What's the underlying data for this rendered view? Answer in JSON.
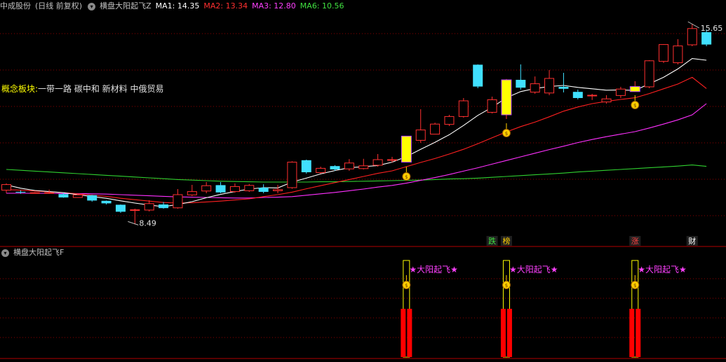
{
  "header": {
    "stock": "中成股份",
    "period": "(日线 前复权)",
    "indicator": "横盘大阳起飞Z",
    "ma": [
      {
        "label": "MA1: 14.35",
        "color": "#ffffff"
      },
      {
        "label": "MA2: 13.34",
        "color": "#ff3030"
      },
      {
        "label": "MA3: 12.80",
        "color": "#ff40ff"
      },
      {
        "label": "MA6: 10.56",
        "color": "#40e040"
      }
    ]
  },
  "concept": {
    "key": "概念板块:",
    "value": "一带一路 碳中和 新材料 中俄贸易"
  },
  "price_labels": {
    "high": "15.65",
    "low": "8.49"
  },
  "markers": [
    {
      "text": "跌",
      "color": "#40e040",
      "day": 34
    },
    {
      "text": "榜",
      "color": "#ffd000",
      "day": 35
    },
    {
      "text": "涨",
      "color": "#ff4040",
      "day": 44
    },
    {
      "text": "财",
      "color": "#ffffff",
      "day": 48
    }
  ],
  "sub": {
    "title": "横盘大阳起飞F",
    "signal": "★大阳起飞★",
    "signal_days": [
      28,
      35,
      44
    ]
  },
  "colors": {
    "up": "#ff3030",
    "down": "#40e0ff",
    "signal": "#ffff00",
    "grid": "#8b0000"
  },
  "chart_data": {
    "type": "candlestick",
    "ylim": [
      8.0,
      16.0
    ],
    "candles": [
      [
        9.71,
        9.91,
        9.61,
        9.95
      ],
      [
        9.65,
        9.63,
        9.58,
        9.7
      ],
      [
        9.62,
        9.62,
        9.6,
        9.64
      ],
      [
        9.61,
        9.62,
        9.58,
        9.73
      ],
      [
        9.57,
        9.45,
        9.44,
        9.62
      ],
      [
        9.45,
        9.54,
        9.44,
        9.58
      ],
      [
        9.53,
        9.34,
        9.3,
        9.54
      ],
      [
        9.33,
        9.24,
        9.2,
        9.34
      ],
      [
        9.19,
        8.94,
        8.9,
        9.2
      ],
      [
        8.99,
        9.01,
        8.49,
        9.05
      ],
      [
        9.0,
        9.23,
        8.95,
        9.35
      ],
      [
        9.2,
        9.07,
        9.05,
        9.29
      ],
      [
        9.08,
        9.55,
        9.05,
        9.75
      ],
      [
        9.54,
        9.66,
        9.5,
        9.9
      ],
      [
        9.68,
        9.87,
        9.6,
        10.0
      ],
      [
        9.89,
        9.63,
        9.6,
        10.0
      ],
      [
        9.66,
        9.84,
        9.62,
        9.95
      ],
      [
        9.69,
        9.88,
        9.65,
        9.93
      ],
      [
        9.8,
        9.65,
        9.6,
        9.92
      ],
      [
        9.69,
        9.73,
        9.6,
        9.9
      ],
      [
        9.8,
        10.71,
        9.76,
        10.74
      ],
      [
        10.78,
        10.35,
        10.3,
        10.8
      ],
      [
        10.34,
        10.49,
        10.3,
        10.55
      ],
      [
        10.57,
        10.45,
        10.4,
        10.6
      ],
      [
        10.47,
        10.68,
        10.4,
        10.82
      ],
      [
        10.48,
        10.58,
        10.45,
        10.83
      ],
      [
        10.6,
        10.8,
        10.55,
        11.0
      ],
      [
        10.8,
        10.8,
        10.7,
        10.9
      ],
      [
        10.71,
        11.64,
        10.7,
        11.65
      ],
      [
        11.49,
        11.86,
        11.4,
        12.6
      ],
      [
        11.71,
        12.07,
        11.7,
        12.12
      ],
      [
        12.06,
        12.34,
        12.0,
        12.4
      ],
      [
        12.34,
        12.9,
        12.3,
        13.0
      ],
      [
        14.19,
        13.41,
        13.35,
        14.2
      ],
      [
        12.49,
        12.94,
        12.45,
        13.05
      ],
      [
        12.4,
        13.65,
        12.25,
        13.68
      ],
      [
        13.65,
        13.37,
        13.3,
        14.2
      ],
      [
        13.21,
        13.51,
        13.15,
        13.77
      ],
      [
        13.18,
        13.7,
        13.1,
        14.0
      ],
      [
        13.4,
        13.33,
        13.2,
        13.9
      ],
      [
        13.22,
        13.0,
        12.95,
        13.3
      ],
      [
        13.1,
        13.1,
        12.93,
        13.15
      ],
      [
        12.86,
        12.97,
        12.8,
        13.1
      ],
      [
        13.09,
        13.32,
        13.0,
        13.4
      ],
      [
        13.23,
        13.41,
        13.25,
        13.6
      ],
      [
        13.4,
        14.33,
        13.35,
        14.35
      ],
      [
        14.31,
        14.91,
        14.25,
        14.92
      ],
      [
        14.26,
        14.86,
        14.2,
        15.1
      ],
      [
        14.9,
        15.48,
        14.85,
        15.65
      ],
      [
        15.35,
        14.91,
        14.85,
        15.45
      ]
    ],
    "ma1": [
      9.9,
      9.78,
      9.7,
      9.66,
      9.62,
      9.55,
      9.48,
      9.42,
      9.33,
      9.25,
      9.18,
      9.12,
      9.2,
      9.3,
      9.44,
      9.56,
      9.66,
      9.75,
      9.8,
      9.79,
      10.0,
      10.14,
      10.29,
      10.41,
      10.51,
      10.55,
      10.59,
      10.71,
      10.91,
      11.17,
      11.42,
      11.69,
      12.02,
      12.38,
      12.67,
      13.01,
      13.23,
      13.34,
      13.41,
      13.45,
      13.38,
      13.33,
      13.28,
      13.29,
      13.27,
      13.51,
      13.74,
      14.04,
      14.41,
      14.35
    ],
    "ma2": [
      9.73,
      9.71,
      9.68,
      9.65,
      9.62,
      9.58,
      9.53,
      9.49,
      9.42,
      9.37,
      9.32,
      9.27,
      9.25,
      9.26,
      9.29,
      9.32,
      9.36,
      9.4,
      9.48,
      9.55,
      9.64,
      9.76,
      9.87,
      9.98,
      10.09,
      10.2,
      10.31,
      10.4,
      10.55,
      10.7,
      10.84,
      11.0,
      11.17,
      11.37,
      11.58,
      11.79,
      11.98,
      12.14,
      12.33,
      12.53,
      12.68,
      12.8,
      12.88,
      12.95,
      13.01,
      13.16,
      13.33,
      13.5,
      13.74,
      13.34
    ],
    "ma3": [
      9.6,
      9.6,
      9.6,
      9.6,
      9.59,
      9.59,
      9.58,
      9.57,
      9.55,
      9.53,
      9.51,
      9.49,
      9.47,
      9.46,
      9.45,
      9.44,
      9.43,
      9.43,
      9.45,
      9.46,
      9.48,
      9.53,
      9.58,
      9.63,
      9.69,
      9.75,
      9.82,
      9.88,
      9.96,
      10.06,
      10.16,
      10.27,
      10.39,
      10.51,
      10.64,
      10.77,
      10.9,
      11.03,
      11.16,
      11.28,
      11.41,
      11.52,
      11.62,
      11.71,
      11.8,
      11.93,
      12.07,
      12.22,
      12.4,
      12.8
    ],
    "ma6": [
      10.45,
      10.42,
      10.39,
      10.36,
      10.33,
      10.3,
      10.27,
      10.24,
      10.21,
      10.18,
      10.15,
      10.12,
      10.09,
      10.07,
      10.05,
      10.03,
      10.02,
      10.01,
      10.0,
      10.0,
      10.0,
      10.0,
      10.01,
      10.01,
      10.02,
      10.03,
      10.04,
      10.05,
      10.06,
      10.07,
      10.09,
      10.11,
      10.12,
      10.14,
      10.17,
      10.2,
      10.23,
      10.26,
      10.29,
      10.32,
      10.36,
      10.39,
      10.42,
      10.45,
      10.48,
      10.51,
      10.54,
      10.57,
      10.61,
      10.56
    ]
  }
}
